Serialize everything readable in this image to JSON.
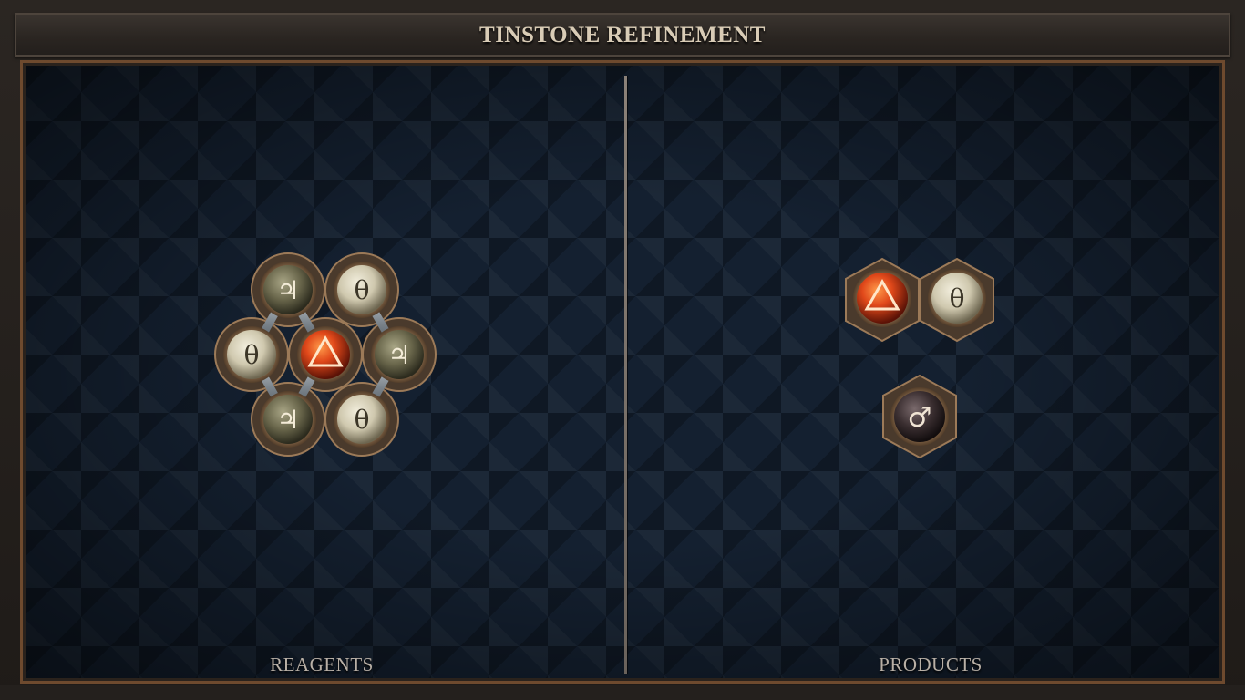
{
  "title": "TINSTONE REFINEMENT",
  "panels": {
    "reagents_label": "REAGENTS",
    "products_label": "PRODUCTS"
  },
  "atom_types": {
    "fire": {
      "glyph": "🜂",
      "icon": "fire-triangle-icon",
      "color": "#e0481a"
    },
    "salt": {
      "glyph": "θ",
      "icon": "salt-theta-icon",
      "color": "#d8d2bc"
    },
    "tin": {
      "glyph": "♃",
      "icon": "tin-jupiter-icon",
      "color": "#6e6b52"
    },
    "iron": {
      "glyph": "♂",
      "icon": "iron-mars-icon",
      "color": "#3a2e30"
    }
  },
  "reagents": {
    "atoms": [
      {
        "type": "tin",
        "glyph": "♃"
      },
      {
        "type": "salt",
        "glyph": "θ"
      },
      {
        "type": "salt",
        "glyph": "θ"
      },
      {
        "type": "fire",
        "glyph": "🜂"
      },
      {
        "type": "tin",
        "glyph": "♃"
      },
      {
        "type": "tin",
        "glyph": "♃"
      },
      {
        "type": "salt",
        "glyph": "θ"
      }
    ]
  },
  "products": {
    "molecule_1": [
      {
        "type": "fire",
        "glyph": "🜂"
      },
      {
        "type": "salt",
        "glyph": "θ"
      }
    ],
    "molecule_2": [
      {
        "type": "iron",
        "glyph": "♂"
      }
    ]
  }
}
